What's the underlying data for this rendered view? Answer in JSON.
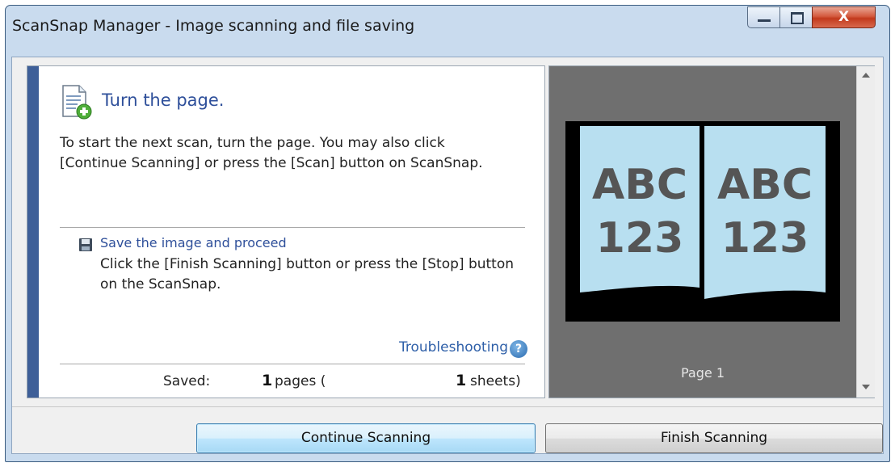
{
  "window": {
    "title": "ScanSnap Manager - Image scanning and file saving",
    "controls": {
      "minimize": "minimize",
      "maximize": "maximize",
      "close": "X"
    }
  },
  "main": {
    "heading": "Turn the page.",
    "description": "To start the next scan, turn the page. You may also click [Continue Scanning] or press the [Scan] button on ScanSnap.",
    "save_title": "Save the image and proceed",
    "save_description": "Click the [Finish Scanning] button or press the [Stop] button on the ScanSnap.",
    "troubleshooting": "Troubleshooting",
    "help_glyph": "?",
    "status": {
      "saved_label": "Saved:",
      "pages_count": "1",
      "pages_label": "pages (",
      "sheets_count": "1",
      "sheets_label": "sheets)"
    }
  },
  "preview": {
    "left_page_text": [
      "ABC",
      "123"
    ],
    "right_page_text": [
      "ABC",
      "123"
    ],
    "page_label": "Page 1"
  },
  "buttons": {
    "continue": "Continue Scanning",
    "finish": "Finish Scanning"
  },
  "icons": {
    "heading": "document-add-icon",
    "save": "floppy-disk-icon",
    "help": "help-icon"
  },
  "colors": {
    "accent": "#3e5f98",
    "link": "#2e5fa8",
    "heading": "#2e4f9a",
    "page_fill": "#b8dff0",
    "ink": "#555555"
  }
}
